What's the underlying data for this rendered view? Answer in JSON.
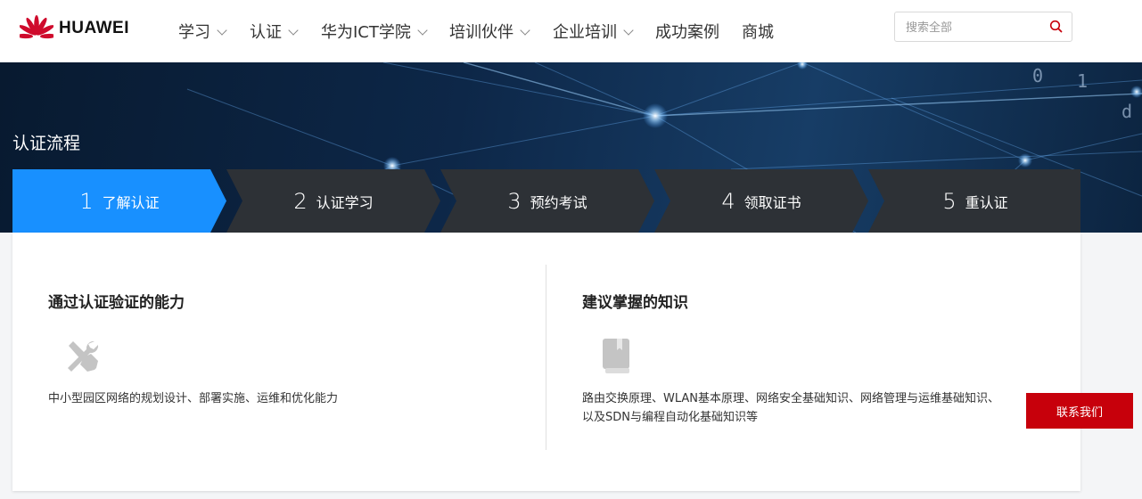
{
  "header": {
    "brand": "HUAWEI",
    "nav": [
      {
        "label": "学习",
        "dropdown": true
      },
      {
        "label": "认证",
        "dropdown": true
      },
      {
        "label": "华为ICT学院",
        "dropdown": true
      },
      {
        "label": "培训伙伴",
        "dropdown": true
      },
      {
        "label": "企业培训",
        "dropdown": true
      },
      {
        "label": "成功案例",
        "dropdown": false
      },
      {
        "label": "商城",
        "dropdown": false
      }
    ],
    "search": {
      "placeholder": "搜索全部",
      "value": "",
      "icon": "search-icon"
    }
  },
  "banner": {
    "title": "认证流程"
  },
  "steps": [
    {
      "num": "1",
      "label": "了解认证",
      "active": true
    },
    {
      "num": "2",
      "label": "认证学习",
      "active": false
    },
    {
      "num": "3",
      "label": "预约考试",
      "active": false
    },
    {
      "num": "4",
      "label": "领取证书",
      "active": false
    },
    {
      "num": "5",
      "label": "重认证",
      "active": false
    }
  ],
  "content": {
    "left": {
      "title": "通过认证验证的能力",
      "icon": "tools-icon",
      "desc": "中小型园区网络的规划设计、部署实施、运维和优化能力"
    },
    "right": {
      "title": "建议掌握的知识",
      "icon": "book-icon",
      "desc_line1": "路由交换原理、WLAN基本原理、网络安全基础知识、网络管理与运维基础知识、",
      "desc_line2": "以及SDN与编程自动化基础知识等"
    }
  },
  "contact": {
    "label": "联系我们"
  },
  "colors": {
    "accent": "#1890ff",
    "step_inactive": "#2d3136",
    "brand_red": "#c7000b",
    "logo_red": "#cf0a2c"
  }
}
